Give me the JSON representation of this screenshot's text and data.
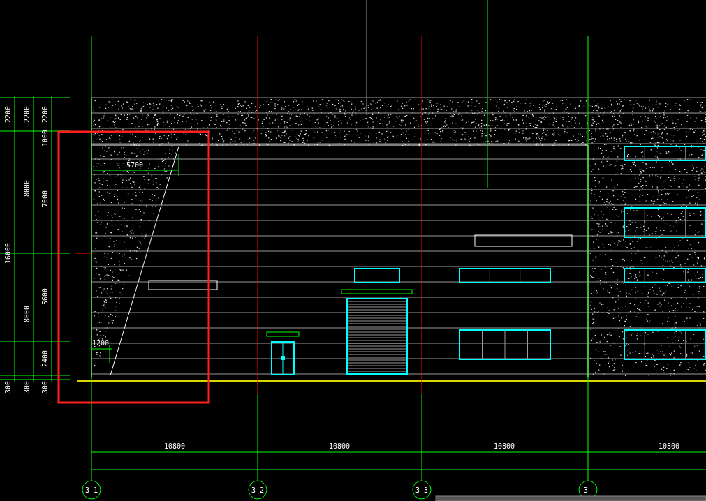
{
  "vertical_dimensions": {
    "outer": [
      {
        "text": "2200"
      },
      {
        "text": "16000"
      },
      {
        "text": "300"
      }
    ],
    "middle": [
      {
        "text": "2200"
      },
      {
        "text": "8000"
      },
      {
        "text": "8000"
      },
      {
        "text": "300"
      }
    ],
    "inner": [
      {
        "text": "2200"
      },
      {
        "text": "1000"
      },
      {
        "text": "7000"
      },
      {
        "text": "5600"
      },
      {
        "text": "2400"
      },
      {
        "text": "300"
      }
    ]
  },
  "window_dimensions": [
    {
      "text": "5700"
    },
    {
      "text": "1200"
    }
  ],
  "horizontal_dimensions": [
    {
      "text": "10800"
    },
    {
      "text": "10800"
    },
    {
      "text": "10800"
    },
    {
      "text": "10800"
    }
  ],
  "grid_bubbles": [
    {
      "label": "3-1"
    },
    {
      "label": "3-2"
    },
    {
      "label": "3-3"
    },
    {
      "label": "3-"
    }
  ]
}
